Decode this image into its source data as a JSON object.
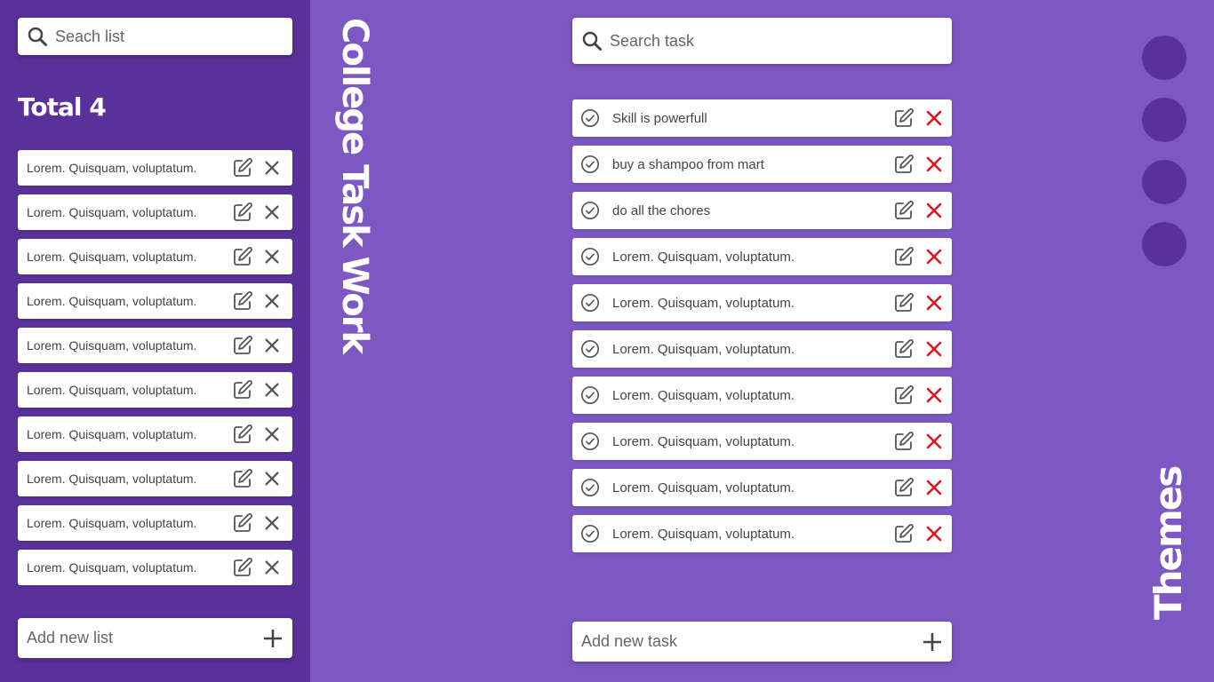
{
  "sidebar": {
    "search": {
      "placeholder": "Seach list",
      "icon": "search-icon"
    },
    "total_label": "Total 4",
    "lists": [
      {
        "label": "Lorem. Quisquam, voluptatum."
      },
      {
        "label": "Lorem. Quisquam, voluptatum."
      },
      {
        "label": "Lorem. Quisquam, voluptatum."
      },
      {
        "label": "Lorem. Quisquam, voluptatum."
      },
      {
        "label": "Lorem. Quisquam, voluptatum."
      },
      {
        "label": "Lorem. Quisquam, voluptatum."
      },
      {
        "label": "Lorem. Quisquam, voluptatum."
      },
      {
        "label": "Lorem. Quisquam, voluptatum."
      },
      {
        "label": "Lorem. Quisquam, voluptatum."
      },
      {
        "label": "Lorem. Quisquam, voluptatum."
      }
    ],
    "add_list": {
      "placeholder": "Add new list",
      "icon": "plus-icon"
    }
  },
  "main": {
    "title": "College Task Work",
    "search": {
      "placeholder": "Search task",
      "icon": "search-icon"
    },
    "tasks": [
      {
        "label": "Skill is powerfull"
      },
      {
        "label": "buy a shampoo from mart"
      },
      {
        "label": "do all the chores"
      },
      {
        "label": "Lorem. Quisquam, voluptatum."
      },
      {
        "label": "Lorem. Quisquam, voluptatum."
      },
      {
        "label": "Lorem. Quisquam, voluptatum."
      },
      {
        "label": "Lorem. Quisquam, voluptatum."
      },
      {
        "label": "Lorem. Quisquam, voluptatum."
      },
      {
        "label": "Lorem. Quisquam, voluptatum."
      },
      {
        "label": "Lorem. Quisquam, voluptatum."
      }
    ],
    "add_task": {
      "placeholder": "Add new task",
      "icon": "plus-icon"
    }
  },
  "themes": {
    "label": "Themes",
    "swatches": [
      "#5a319a",
      "#5a319a",
      "#5a319a",
      "#5a319a"
    ]
  },
  "colors": {
    "background": "#7e58c2",
    "sidebar": "#5a319a",
    "delete_accent": "#e0141e",
    "icon_gray": "#555555"
  }
}
